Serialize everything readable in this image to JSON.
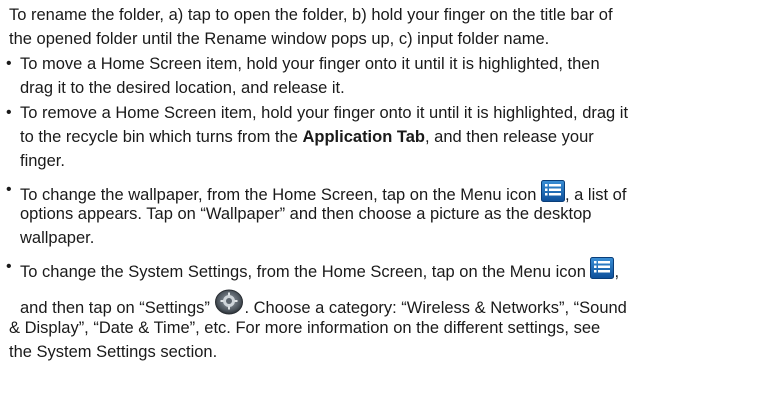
{
  "intro": {
    "line1": "To rename the folder, a) tap to open the folder, b) hold your finger on the title bar of",
    "line2": "the opened folder until the Rename window pops up, c) input folder name."
  },
  "bullets": {
    "b1": {
      "line1": "To move a Home Screen item, hold your finger onto it until it is highlighted, then",
      "line2": "drag it to the desired location, and release it."
    },
    "b2": {
      "line1": "To remove a Home Screen item, hold your finger onto it until it is highlighted, drag it",
      "line2_pre": "to the recycle bin which turns from the ",
      "line2_bold": "Application Tab",
      "line2_post": ", and then release your",
      "line3": "finger."
    },
    "b3": {
      "line1_pre": "To change the wallpaper, from the Home Screen, tap on the Menu icon ",
      "line1_post": ", a list of",
      "line2": "options appears. Tap on “Wallpaper” and then choose a picture as the desktop",
      "line3": "wallpaper."
    },
    "b4": {
      "line1_pre": "To change the System Settings, from the Home Screen, tap on the Menu icon ",
      "line1_post": ",",
      "line2_pre": "and then tap on “Settings” ",
      "line2_post": ". Choose a category: “Wireless & Networks”, “Sound",
      "line3": "& Display”, “Date & Time”, etc. For more information on the different settings, see",
      "line4": "the System Settings section."
    }
  },
  "bullet_char": "•",
  "icons": {
    "menu": "menu-icon",
    "settings": "settings-icon"
  }
}
